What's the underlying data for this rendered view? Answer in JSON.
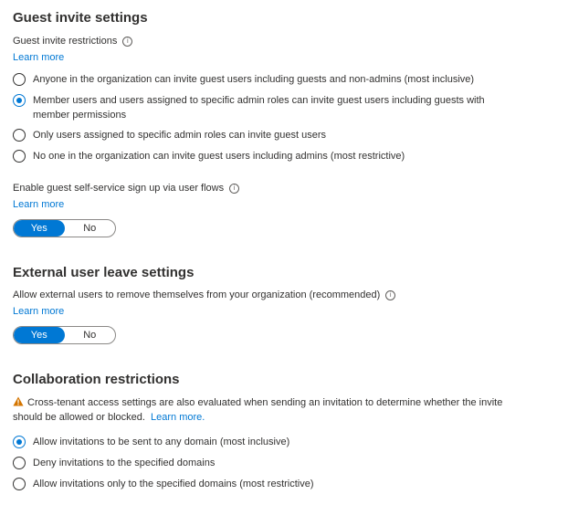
{
  "guest_invite": {
    "title": "Guest invite settings",
    "restrictions_label": "Guest invite restrictions",
    "learn_more": "Learn more",
    "options": [
      {
        "label": "Anyone in the organization can invite guest users including guests and non-admins (most inclusive)",
        "selected": false
      },
      {
        "label": "Member users and users assigned to specific admin roles can invite guest users including guests with",
        "label2": "member permissions",
        "selected": true
      },
      {
        "label": "Only users assigned to specific admin roles can invite guest users",
        "selected": false
      },
      {
        "label": "No one in the organization can invite guest users including admins (most restrictive)",
        "selected": false
      }
    ],
    "self_service_label": "Enable guest self-service sign up via user flows",
    "self_service_learn_more": "Learn more",
    "self_service_toggle": {
      "yes": "Yes",
      "no": "No",
      "value": "Yes"
    }
  },
  "external_leave": {
    "title": "External user leave settings",
    "label": "Allow external users to remove themselves from your organization (recommended)",
    "learn_more": "Learn more",
    "toggle": {
      "yes": "Yes",
      "no": "No",
      "value": "Yes"
    }
  },
  "collaboration": {
    "title": "Collaboration restrictions",
    "warning_text": "Cross-tenant access settings are also evaluated when sending an invitation to determine whether the invite should be allowed or blocked.",
    "warning_link": "Learn more.",
    "options": [
      {
        "label": "Allow invitations to be sent to any domain (most inclusive)",
        "selected": true
      },
      {
        "label": "Deny invitations to the specified domains",
        "selected": false
      },
      {
        "label": "Allow invitations only to the specified domains (most restrictive)",
        "selected": false
      }
    ]
  },
  "colors": {
    "accent": "#0078d4",
    "warning": "#d47500"
  }
}
